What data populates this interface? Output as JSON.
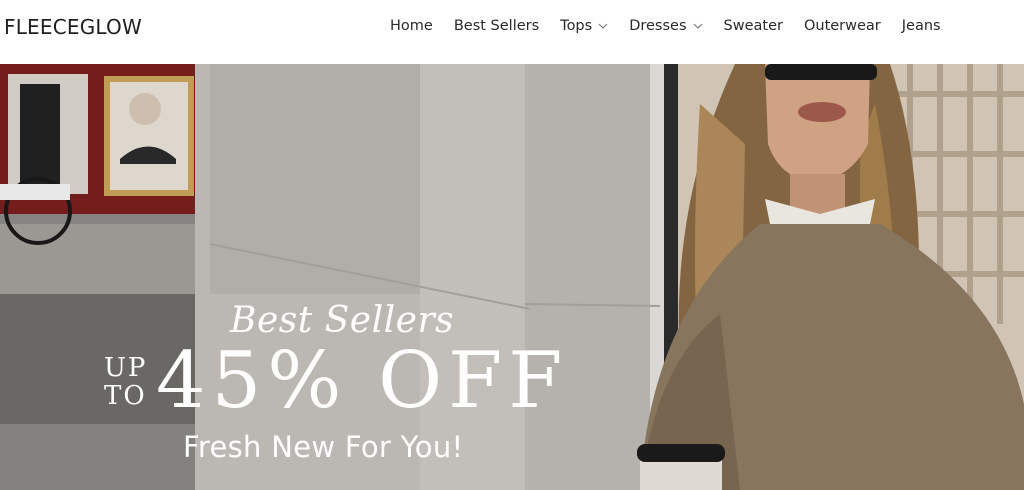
{
  "brand": {
    "name": "FLEECEGLOW"
  },
  "nav": {
    "items": [
      {
        "label": "Home",
        "has_dropdown": false
      },
      {
        "label": "Best Sellers",
        "has_dropdown": false
      },
      {
        "label": "Tops",
        "has_dropdown": true
      },
      {
        "label": "Dresses",
        "has_dropdown": true
      },
      {
        "label": "Sweater",
        "has_dropdown": false
      },
      {
        "label": "Outerwear",
        "has_dropdown": false
      },
      {
        "label": "Jeans",
        "has_dropdown": false
      }
    ]
  },
  "hero": {
    "title": "Best Sellers",
    "up_line1": "UP",
    "up_line2": "TO",
    "discount": "45% OFF",
    "subtitle": "Fresh New For You!"
  },
  "colors": {
    "header_bg": "#ffffff",
    "text": "#2a2a2a",
    "hero_text": "#ffffff"
  }
}
